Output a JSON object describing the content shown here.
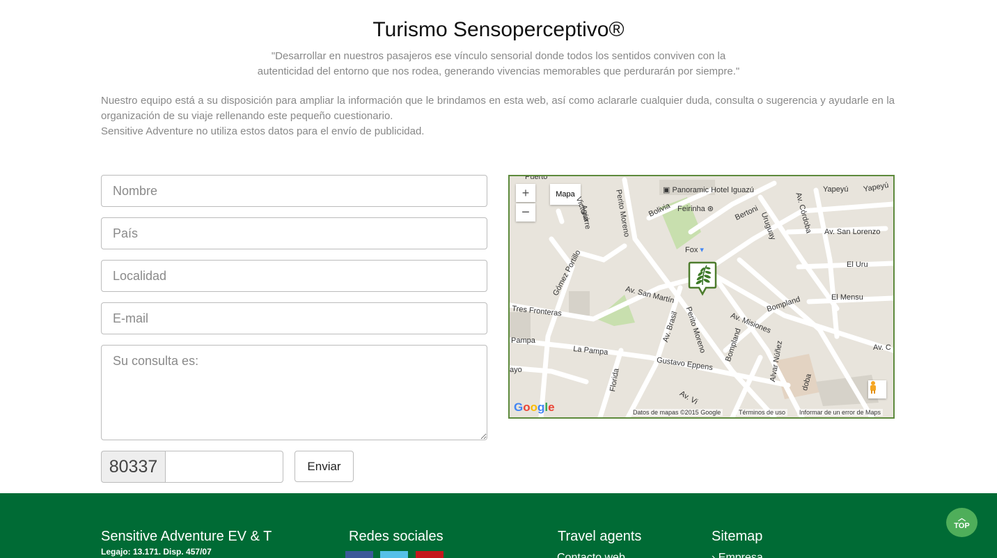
{
  "header": {
    "title": "Turismo Sensoperceptivo®",
    "quote_line1": "\"Desarrollar en nuestros pasajeros ese vínculo sensorial donde todos los sentidos conviven con la",
    "quote_line2": "autenticidad del entorno que nos rodea, generando vivencias memorables que perdurarán por siempre.\""
  },
  "intro": {
    "line1": "Nuestro equipo está a su disposición para ampliar la información que le brindamos en esta web, así como aclararle cualquier duda, consulta o sugerencia y ayudarle en la organización de su viaje rellenando este pequeño cuestionario.",
    "line2": "Sensitive Adventure no utiliza estos datos para el envío de publicidad."
  },
  "form": {
    "nombre_placeholder": "Nombre",
    "pais_placeholder": "País",
    "localidad_placeholder": "Localidad",
    "email_placeholder": "E-mail",
    "consulta_placeholder": "Su consulta es:",
    "captcha_code": "80337",
    "submit_label": "Enviar"
  },
  "map": {
    "zoom_in": "+",
    "zoom_out": "−",
    "type_label": "Mapa",
    "streets": {
      "puerto": "Puerto",
      "moreno_top": "Perito Moreno",
      "aguirre": "Aguirre",
      "victoria": "Victoria",
      "bolivia": "Bolivia",
      "bertoni": "Bertoni",
      "uruguay": "Uruguay",
      "cordoba": "Av. Córdoba",
      "yapeyu1": "Yapeyú",
      "yapeyu2": "Yapeyú",
      "san_lorenzo": "Av. San Lorenzo",
      "el_uru": "El Uru",
      "el_mensu": "El Mensu",
      "gomez_portillo": "Gómez Portillo",
      "san_martin": "Av. San Martín",
      "tres_fronteras": "Tres Fronteras",
      "brasil": "Av. Brasil",
      "perito_moreno": "Perito Moreno",
      "bompland1": "Bompland",
      "bompland2": "Bompland",
      "misiones": "Av. Misiones",
      "pampa": "Pampa",
      "la_pampa": "La Pampa",
      "alvar_nunez": "Alvar Núñez",
      "gustavo_eppens": "Gustavo Eppens",
      "florida": "Florida",
      "ayo": "ayo",
      "av_vic": "Av. Vi",
      "cordoba_bottom": "doba",
      "av_c": "Av. C"
    },
    "poi": {
      "hotel": "Panoramic Hotel Iguazú",
      "feirinha": "Feirinha",
      "fox": "Fox"
    },
    "footer_data": "Datos de mapas ©2015 Google",
    "footer_terms": "Términos de uso",
    "footer_report": "Informar de un error de Maps"
  },
  "footer": {
    "company": "Sensitive Adventure EV & T",
    "legajo": "Legajo: 13.171. Disp. 457/07",
    "social_title": "Redes sociales",
    "travel_title": "Travel agents",
    "sitemap_title": "Sitemap",
    "travel_link": "Contacto web",
    "sitemap_link": "Empresa",
    "social_colors": [
      "#3b5998",
      "#55c0e8",
      "#c4161c"
    ]
  },
  "top_button": {
    "label": "TOP"
  }
}
